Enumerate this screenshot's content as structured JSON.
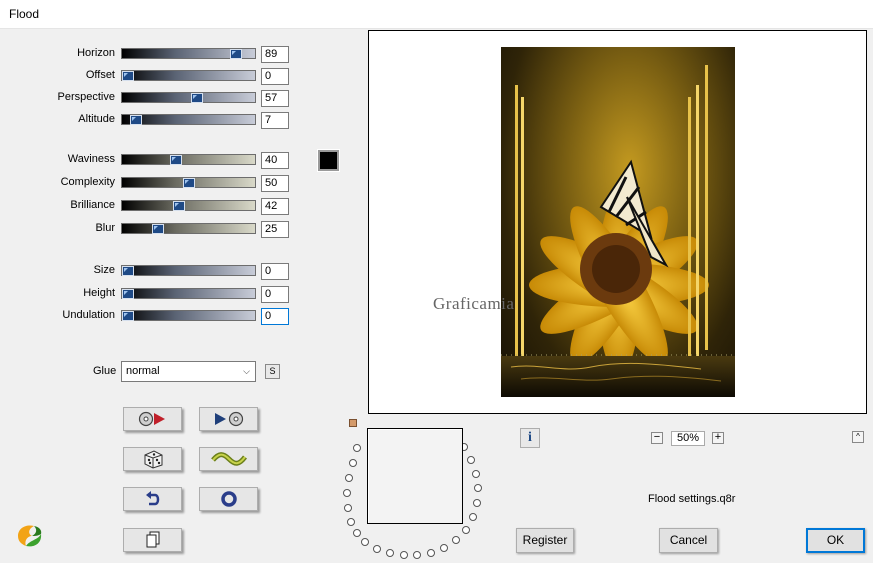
{
  "window": {
    "title": "Flood"
  },
  "params": [
    {
      "label": "Horizon",
      "value": "89",
      "level": 0.89,
      "style": "blue"
    },
    {
      "label": "Offset",
      "value": "0",
      "level": 0.0,
      "style": "blue"
    },
    {
      "label": "Perspective",
      "value": "57",
      "level": 0.57,
      "style": "blue"
    },
    {
      "label": "Altitude",
      "value": "7",
      "level": 0.07,
      "style": "blue"
    },
    {
      "label": "Waviness",
      "value": "40",
      "level": 0.4,
      "style": "tan"
    },
    {
      "label": "Complexity",
      "value": "50",
      "level": 0.5,
      "style": "tan"
    },
    {
      "label": "Brilliance",
      "value": "42",
      "level": 0.42,
      "style": "tan"
    },
    {
      "label": "Blur",
      "value": "25",
      "level": 0.25,
      "style": "tan"
    },
    {
      "label": "Size",
      "value": "0",
      "level": 0.0,
      "style": "blue"
    },
    {
      "label": "Height",
      "value": "0",
      "level": 0.0,
      "style": "blue"
    },
    {
      "label": "Undulation",
      "value": "0",
      "level": 0.0,
      "style": "blue"
    }
  ],
  "color_swatch": "#000000",
  "glue": {
    "label": "Glue",
    "value": "normal",
    "s_button": "S"
  },
  "tool_buttons": [
    {
      "name": "randomize-back-icon"
    },
    {
      "name": "randomize-forward-icon"
    },
    {
      "name": "dice-icon"
    },
    {
      "name": "wave-icon"
    },
    {
      "name": "undo-icon"
    },
    {
      "name": "reset-circle-icon"
    },
    {
      "name": "copy-icon"
    }
  ],
  "preview": {
    "watermark": "Graficamia"
  },
  "zoom": {
    "value": "50%",
    "minus": "−",
    "plus": "+"
  },
  "info_label": "i",
  "collapse_label": "^",
  "settings_file": "Flood settings.q8r",
  "buttons": {
    "register": "Register",
    "cancel": "Cancel",
    "ok": "OK"
  }
}
